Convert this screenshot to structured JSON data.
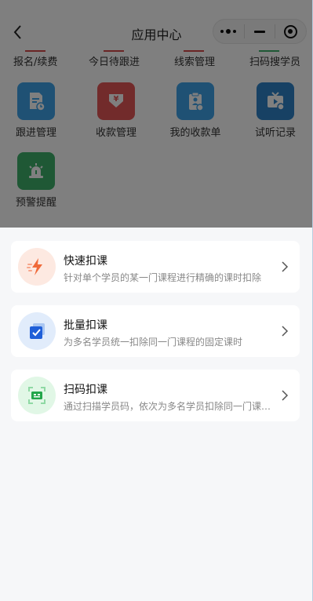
{
  "nav": {
    "title": "应用中心"
  },
  "tabs": [
    {
      "label": "报名/续费"
    },
    {
      "label": "今日待跟进"
    },
    {
      "label": "线索管理"
    },
    {
      "label": "扫码搜学员"
    }
  ],
  "apps": [
    {
      "label": "跟进管理",
      "icon": "document-clock-icon",
      "color": "#3ea3e8"
    },
    {
      "label": "收款管理",
      "icon": "money-bag-icon",
      "color": "#e45656"
    },
    {
      "label": "我的收款单",
      "icon": "clipboard-person-icon",
      "color": "#3ea3e8"
    },
    {
      "label": "试听记录",
      "icon": "tv-play-icon",
      "color": "#2e83c8"
    },
    {
      "label": "预警提醒",
      "icon": "alarm-light-icon",
      "color": "#3fb06a"
    }
  ],
  "options": [
    {
      "title": "快速扣课",
      "desc": "针对单个学员的某一门课程进行精确的课时扣除",
      "icon": "lightning-icon",
      "color": "#fde9e1"
    },
    {
      "title": "批量扣课",
      "desc": "为多名学员统一扣除同一门课程的固定课时",
      "icon": "batch-check-icon",
      "color": "#e1ecfb"
    },
    {
      "title": "扫码扣课",
      "desc": "通过扫描学员码，依次为多名学员扣除同一门课程的固定课时",
      "icon": "scan-code-icon",
      "color": "#e1f7e6"
    }
  ]
}
